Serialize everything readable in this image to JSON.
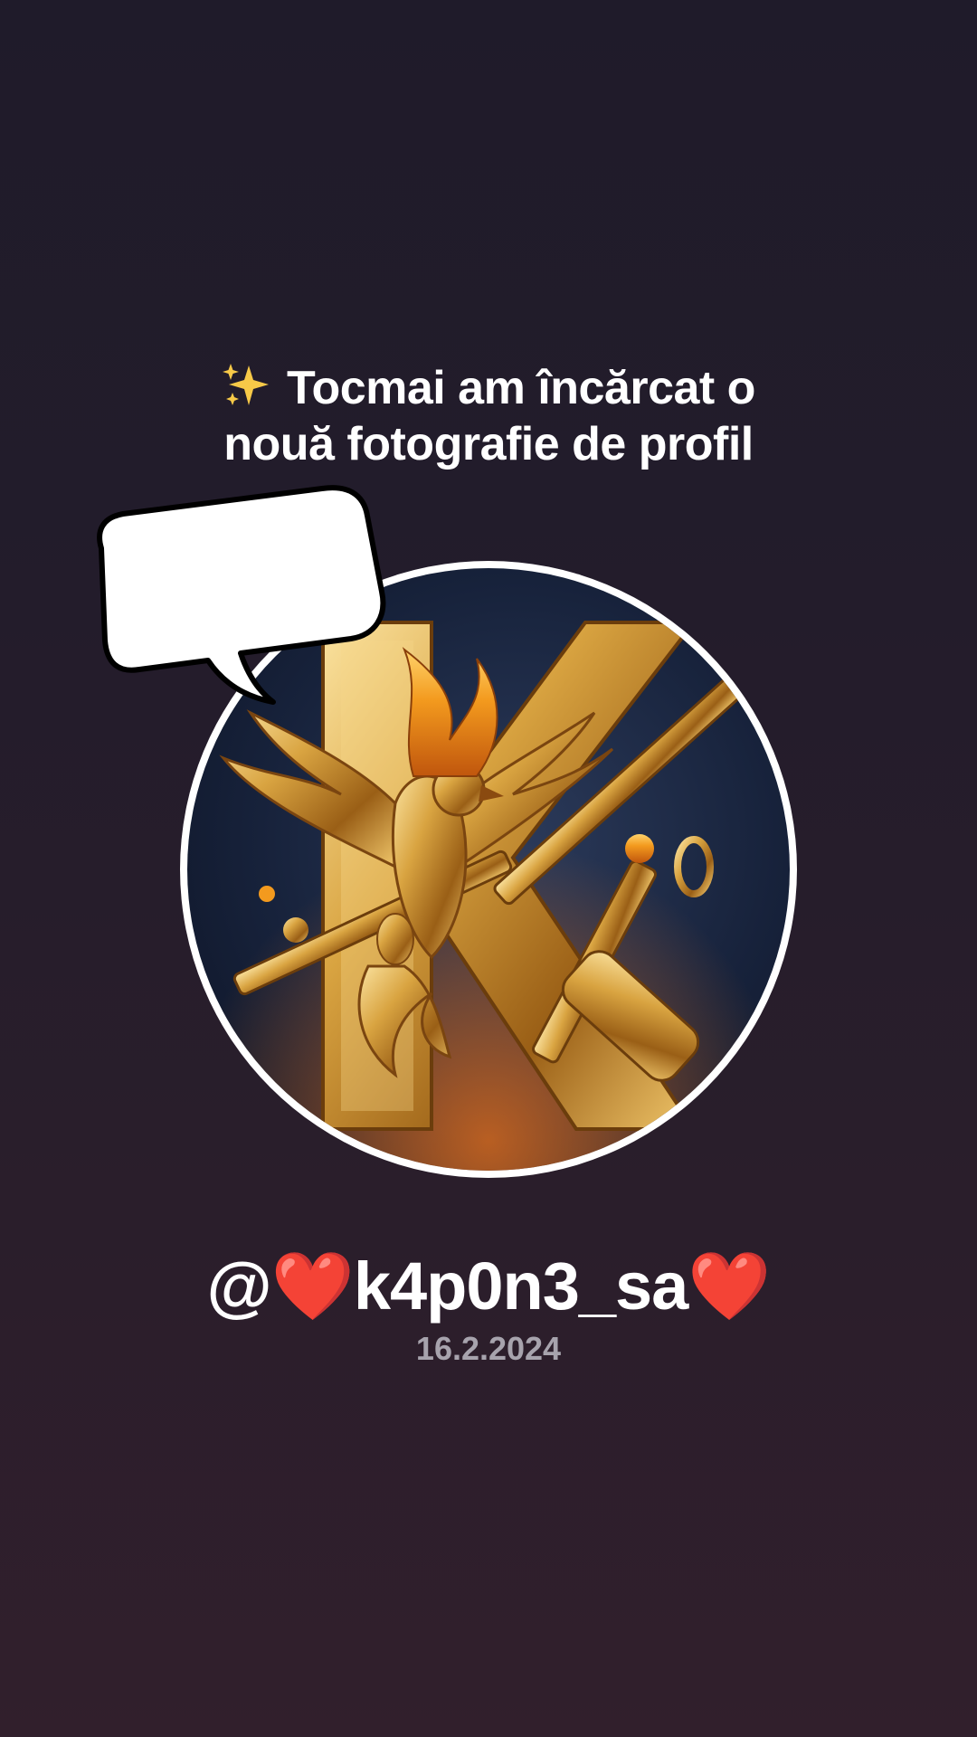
{
  "headline": {
    "icon": "sparkles-icon",
    "line1": "Tocmai am încărcat o",
    "line2": "nouă fotografie de profil"
  },
  "profile": {
    "avatar": "profile-photo",
    "username": "@❤️k4p0n3_sa❤️",
    "date": "16.2.2024"
  },
  "speech_bubble": {
    "text": ""
  },
  "colors": {
    "background_top": "#1f1b2a",
    "background_bottom": "#311f2c",
    "text": "#ffffff",
    "date_text": "#a7a3ad",
    "gold": "#d9a441"
  }
}
